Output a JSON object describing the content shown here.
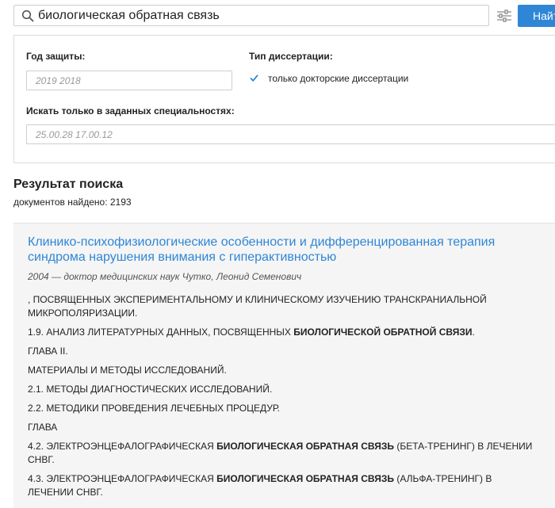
{
  "search": {
    "query": "биологическая обратная связь",
    "find_label": "Найти"
  },
  "filters": {
    "year_label": "Год защиты:",
    "year_value": "2019 2018",
    "type_label": "Тип диссертации:",
    "doctoral_only_label": "только докторские диссертации",
    "doctoral_only_checked": true,
    "specialties_label": "Искать только в заданных специальностях:",
    "specialties_value": "25.00.28 17.00.12"
  },
  "results": {
    "title": "Результат поиска",
    "count_text": "документов найдено: 2193",
    "items": [
      {
        "title": "Клинико-психофизиологические особенности и дифференцированная терапия синдрома нарушения внимания с гиперактивностью",
        "meta": "2004 — доктор медицинских наук Чутко, Леонид Семенович",
        "snippets": [
          {
            "before": ", ПОСВЯЩЕННЫХ ЭКСПЕРИМЕНТАЛЬНОМУ И КЛИНИЧЕСКОМУ ИЗУЧЕНИЮ ТРАНСКРАНИАЛЬНОЙ МИКРОПОЛЯРИЗАЦИИ.",
            "highlight": "",
            "after": ""
          },
          {
            "before": "1.9. АНАЛИЗ ЛИТЕРАТУРНЫХ ДАННЫХ, ПОСВЯЩЕННЫХ ",
            "highlight": "БИОЛОГИЧЕСКОЙ ОБРАТНОЙ СВЯЗИ",
            "after": "."
          },
          {
            "before": "ГЛАВА II.",
            "highlight": "",
            "after": ""
          },
          {
            "before": "МАТЕРИАЛЫ И МЕТОДЫ ИССЛЕДОВАНИЙ.",
            "highlight": "",
            "after": ""
          },
          {
            "before": "2.1. МЕТОДЫ ДИАГНОСТИЧЕСКИХ ИССЛЕДОВАНИЙ.",
            "highlight": "",
            "after": ""
          },
          {
            "before": "2.2. МЕТОДИКИ ПРОВЕДЕНИЯ ЛЕЧЕБНЫХ ПРОЦЕДУР.",
            "highlight": "",
            "after": ""
          },
          {
            "before": "ГЛАВА",
            "highlight": "",
            "after": ""
          },
          {
            "before": "4.2. ЭЛЕКТРОЭНЦЕФАЛОГРАФИЧЕСКАЯ ",
            "highlight": "БИОЛОГИЧЕСКАЯ ОБРАТНАЯ СВЯЗЬ",
            "after": " (БЕТА-ТРЕНИНГ) В ЛЕЧЕНИИ СНВГ."
          },
          {
            "before": "4.3. ЭЛЕКТРОЭНЦЕФАЛОГРАФИЧЕСКАЯ ",
            "highlight": "БИОЛОГИЧЕСКАЯ ОБРАТНАЯ СВЯЗЬ",
            "after": " (АЛЬФА-ТРЕНИНГ) В ЛЕЧЕНИИ СНВГ."
          }
        ]
      }
    ]
  },
  "icons": {
    "search": "search-icon",
    "filter": "sliders-icon",
    "check": "checkmark-icon"
  },
  "colors": {
    "accent": "#2f86d6",
    "card_bg": "#f5f5f5"
  }
}
